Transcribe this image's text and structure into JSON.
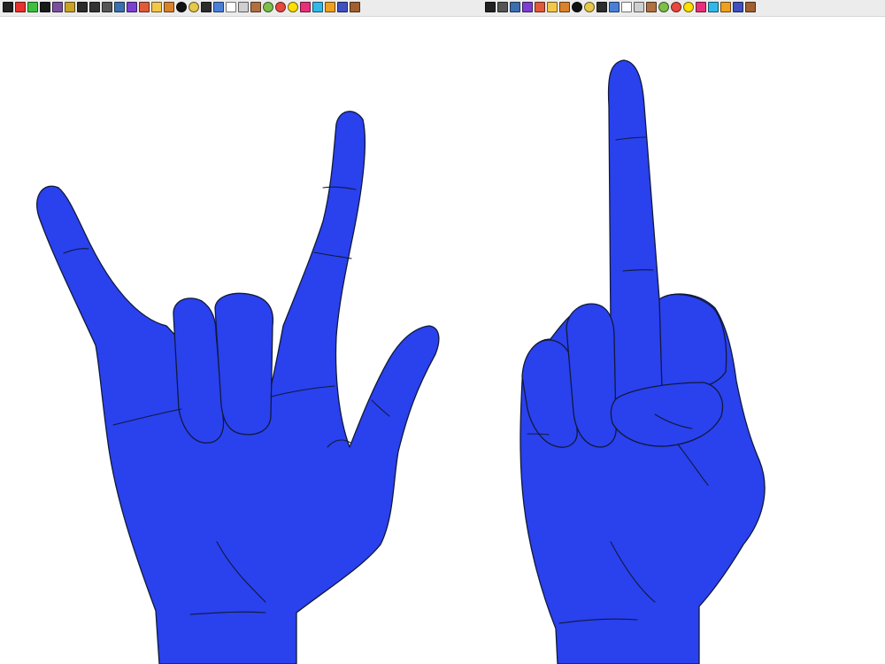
{
  "canvas": {
    "hand_color": "#2a41ee",
    "outline_color": "#101a3a",
    "background": "#ffffff"
  },
  "toolbar": {
    "left_tools": [
      {
        "name": "info-icon",
        "color": "#222222"
      },
      {
        "name": "color-picker-icon",
        "color": "#e8312f"
      },
      {
        "name": "gradient-icon",
        "color": "#3fbf3f"
      },
      {
        "name": "pen-icon",
        "color": "#1a1a1a"
      },
      {
        "name": "drop-icon",
        "color": "#7a4fa0"
      },
      {
        "name": "frame-icon",
        "color": "#c9a227"
      },
      {
        "name": "mask-icon",
        "color": "#2b2b2b"
      },
      {
        "name": "text-icon",
        "color": "#333333"
      },
      {
        "name": "triangle-icon",
        "color": "#555555"
      },
      {
        "name": "lines-icon",
        "color": "#3b6fb0"
      },
      {
        "name": "palette-icon",
        "color": "#7c3fd0"
      },
      {
        "name": "brush-icon",
        "color": "#e05a3a"
      },
      {
        "name": "fill-icon",
        "color": "#f2c74a"
      },
      {
        "name": "mushroom-icon",
        "color": "#d9822b"
      },
      {
        "name": "circle-icon",
        "color": "#111111"
      },
      {
        "name": "ellipse-icon",
        "color": "#e6c84a"
      },
      {
        "name": "shape-icon",
        "color": "#2c2c2c"
      },
      {
        "name": "eraser-icon",
        "color": "#4a7fd8"
      },
      {
        "name": "cursor-icon",
        "color": "#ffffff"
      },
      {
        "name": "stamp-icon",
        "color": "#cfcfcf"
      },
      {
        "name": "hand-icon",
        "color": "#b07040"
      },
      {
        "name": "leaf-icon",
        "color": "#7cc04a"
      },
      {
        "name": "fruit-icon",
        "color": "#e8473f"
      },
      {
        "name": "sun-icon",
        "color": "#ffe000"
      },
      {
        "name": "heart-icon",
        "color": "#e8307a"
      },
      {
        "name": "cloud-icon",
        "color": "#2fb8e8"
      },
      {
        "name": "bucket-icon",
        "color": "#f0a020"
      },
      {
        "name": "pattern-icon",
        "color": "#4050c0"
      },
      {
        "name": "boot-icon",
        "color": "#a06030"
      }
    ],
    "right_tools": [
      {
        "name": "bar-icon",
        "color": "#222222"
      },
      {
        "name": "triangle-icon",
        "color": "#555555"
      },
      {
        "name": "lines-icon",
        "color": "#3b6fb0"
      },
      {
        "name": "palette-icon",
        "color": "#7c3fd0"
      },
      {
        "name": "brush-icon",
        "color": "#e05a3a"
      },
      {
        "name": "fill-icon",
        "color": "#f2c74a"
      },
      {
        "name": "mushroom-icon",
        "color": "#d9822b"
      },
      {
        "name": "circle-icon",
        "color": "#111111"
      },
      {
        "name": "ellipse-icon",
        "color": "#e6c84a"
      },
      {
        "name": "shape-icon",
        "color": "#2c2c2c"
      },
      {
        "name": "eraser-icon",
        "color": "#4a7fd8"
      },
      {
        "name": "cursor-icon",
        "color": "#ffffff"
      },
      {
        "name": "stamp-icon",
        "color": "#cfcfcf"
      },
      {
        "name": "hand-icon",
        "color": "#b07040"
      },
      {
        "name": "leaf-icon",
        "color": "#7cc04a"
      },
      {
        "name": "fruit-icon",
        "color": "#e8473f"
      },
      {
        "name": "sun-icon",
        "color": "#ffe000"
      },
      {
        "name": "heart-icon",
        "color": "#e8307a"
      },
      {
        "name": "cloud-icon",
        "color": "#2fb8e8"
      },
      {
        "name": "bucket-icon",
        "color": "#f0a020"
      },
      {
        "name": "pattern-icon",
        "color": "#4050c0"
      },
      {
        "name": "boot-icon",
        "color": "#a06030"
      }
    ]
  }
}
